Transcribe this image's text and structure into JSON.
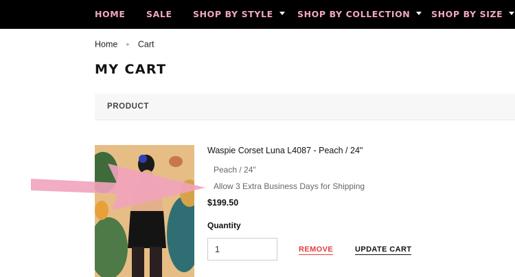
{
  "nav": {
    "items": [
      {
        "label": "HOME",
        "has_dropdown": false
      },
      {
        "label": "SALE",
        "has_dropdown": false
      },
      {
        "label": "SHOP BY STYLE",
        "has_dropdown": true
      },
      {
        "label": "SHOP BY COLLECTION",
        "has_dropdown": true
      },
      {
        "label": "SHOP BY SIZE",
        "has_dropdown": true
      }
    ],
    "text_color": "#f2a7c1",
    "background": "#000000"
  },
  "breadcrumb": {
    "items": [
      "Home",
      "Cart"
    ]
  },
  "page": {
    "title": "MY CART"
  },
  "table": {
    "header_product": "PRODUCT"
  },
  "cart_item": {
    "name": "Waspie Corset Luna L4087 - Peach / 24\"",
    "variant": "Peach / 24\"",
    "shipping_note": "Allow 3 Extra Business Days for Shipping",
    "price": "$199.50",
    "quantity_label": "Quantity",
    "quantity_value": "1",
    "remove_label": "REMOVE",
    "update_label": "UPDATE CART"
  },
  "colors": {
    "remove": "#e23c3c",
    "annotation_arrow": "#f1a3bd"
  },
  "icons": [
    "chevron-right-icon",
    "caret-down-icon",
    "annotation-arrow"
  ]
}
